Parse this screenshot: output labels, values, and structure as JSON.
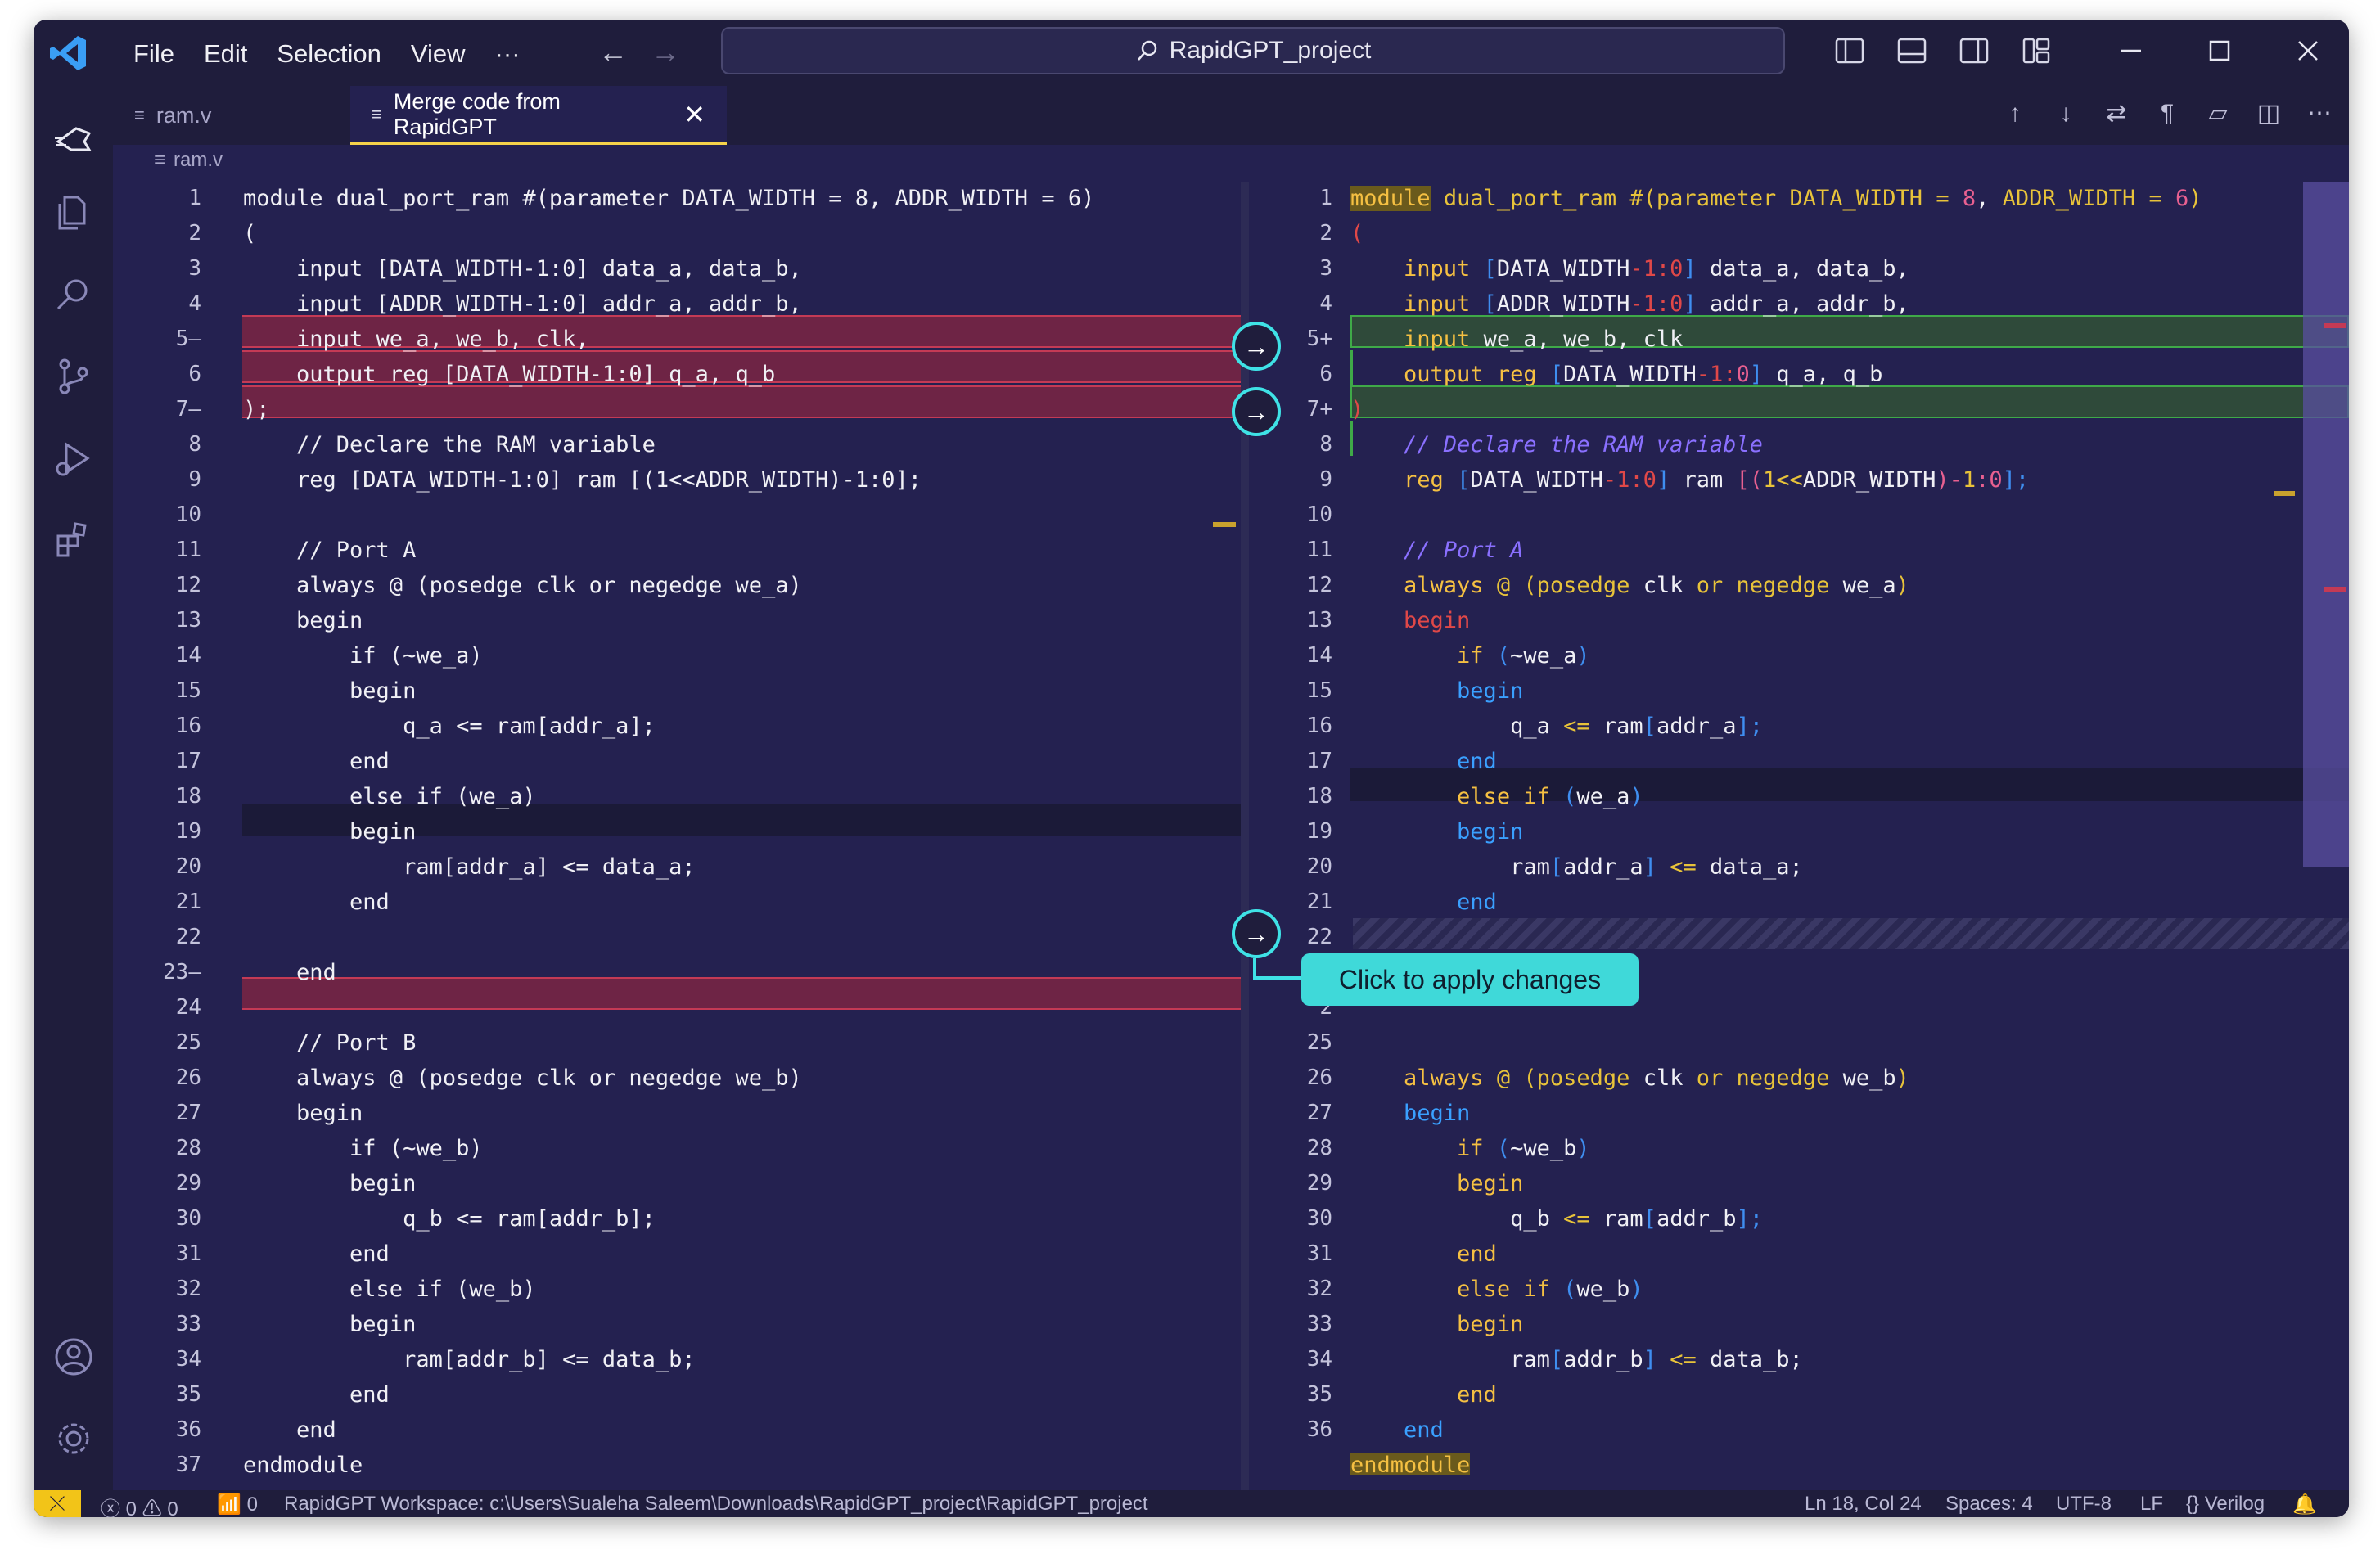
{
  "titlebar": {
    "menu": [
      "File",
      "Edit",
      "Selection",
      "View",
      "···"
    ],
    "search_text": "RapidGPT_project"
  },
  "tabs": [
    {
      "label": "ram.v",
      "active": false
    },
    {
      "label": "Merge code from RapidGPT",
      "active": true
    }
  ],
  "breadcrumb": "ram.v",
  "left_lines": [
    {
      "n": "1",
      "t": "module dual_port_ram #(parameter DATA_WIDTH = 8, ADDR_WIDTH = 6)"
    },
    {
      "n": "2",
      "t": "("
    },
    {
      "n": "3",
      "t": "    input [DATA_WIDTH-1:0] data_a, data_b,"
    },
    {
      "n": "4",
      "t": "    input [ADDR_WIDTH-1:0] addr_a, addr_b,"
    },
    {
      "n": "5—",
      "t": "    input we_a, we_b, clk,"
    },
    {
      "n": "6",
      "t": "    output reg [DATA_WIDTH-1:0] q_a, q_b"
    },
    {
      "n": "7—",
      "t": ");"
    },
    {
      "n": "8",
      "t": "    // Declare the RAM variable"
    },
    {
      "n": "9",
      "t": "    reg [DATA_WIDTH-1:0] ram [(1<<ADDR_WIDTH)-1:0];"
    },
    {
      "n": "10",
      "t": ""
    },
    {
      "n": "11",
      "t": "    // Port A"
    },
    {
      "n": "12",
      "t": "    always @ (posedge clk or negedge we_a)"
    },
    {
      "n": "13",
      "t": "    begin"
    },
    {
      "n": "14",
      "t": "        if (~we_a)"
    },
    {
      "n": "15",
      "t": "        begin"
    },
    {
      "n": "16",
      "t": "            q_a <= ram[addr_a];"
    },
    {
      "n": "17",
      "t": "        end"
    },
    {
      "n": "18",
      "t": "        else if (we_a)"
    },
    {
      "n": "19",
      "t": "        begin"
    },
    {
      "n": "20",
      "t": "            ram[addr_a] <= data_a;"
    },
    {
      "n": "21",
      "t": "        end"
    },
    {
      "n": "22",
      "t": ""
    },
    {
      "n": "23—",
      "t": "    end"
    },
    {
      "n": "24",
      "t": ""
    },
    {
      "n": "25",
      "t": "    // Port B"
    },
    {
      "n": "26",
      "t": "    always @ (posedge clk or negedge we_b)"
    },
    {
      "n": "27",
      "t": "    begin"
    },
    {
      "n": "28",
      "t": "        if (~we_b)"
    },
    {
      "n": "29",
      "t": "        begin"
    },
    {
      "n": "30",
      "t": "            q_b <= ram[addr_b];"
    },
    {
      "n": "31",
      "t": "        end"
    },
    {
      "n": "32",
      "t": "        else if (we_b)"
    },
    {
      "n": "33",
      "t": "        begin"
    },
    {
      "n": "34",
      "t": "            ram[addr_b] <= data_b;"
    },
    {
      "n": "35",
      "t": "        end"
    },
    {
      "n": "36",
      "t": "    end"
    },
    {
      "n": "37",
      "t": "endmodule"
    }
  ],
  "right_line_numbers": [
    "1",
    "2",
    "3",
    "4",
    "5+",
    "6",
    "7+",
    "8",
    "9",
    "10",
    "11",
    "12",
    "13",
    "14",
    "15",
    "16",
    "17",
    "18",
    "19",
    "20",
    "21",
    "22",
    "2",
    "2",
    "25",
    "26",
    "27",
    "28",
    "29",
    "30",
    "31",
    "32",
    "33",
    "34",
    "35",
    "36"
  ],
  "right_code": {
    "l1": [
      "module",
      "dual_port_ram",
      "#(",
      "parameter",
      "DATA_WIDTH",
      "=",
      "8",
      ",",
      "ADDR_WIDTH",
      "6",
      ")"
    ],
    "l2": "(",
    "l3": [
      "input",
      "[",
      "DATA_WIDTH",
      "-1:0",
      "]",
      "data_a, data_b,"
    ],
    "l4": [
      "input",
      "[",
      "ADDR_WIDTH",
      "-1:0",
      "]",
      "addr_a, addr_b,"
    ],
    "l5": [
      "input",
      "we_a, we_b, clk"
    ],
    "l6": [
      "output",
      "reg",
      "[",
      "DATA_WIDTH",
      "-1:",
      "0",
      "]",
      "q_a, q_b"
    ],
    "l7": ")",
    "l8": "// Declare the RAM variable",
    "l9": [
      "reg",
      "[",
      "DATA_WIDTH",
      "-1:0",
      "]",
      "ram",
      "[(",
      "1",
      "<<",
      "ADDR_WIDTH",
      ")-",
      "1",
      ":0",
      "];"
    ],
    "l11": "// Port A",
    "l12": [
      "always",
      "@",
      "(",
      "posedge",
      "clk",
      "or",
      "negedge",
      "we_a",
      ")"
    ],
    "l13": "begin",
    "l14": [
      "if",
      "(",
      "~we_a",
      ")"
    ],
    "l15": "begin",
    "l16": [
      "q_a",
      "<=",
      "ram",
      "[",
      "addr_a",
      "];"
    ],
    "l17": "end",
    "l18": [
      "else if",
      "(",
      "we_a",
      ")"
    ],
    "l19": "begin",
    "l20": [
      "ram",
      "[",
      "addr_a",
      "]",
      "<=",
      "data_a;"
    ],
    "l21": "end",
    "l25": [
      "always",
      "@",
      "(",
      "posedge",
      "clk",
      "or",
      "negedge",
      "we_b",
      ")"
    ],
    "l26": "begin",
    "l27": [
      "if",
      "(",
      "~we_b",
      ")"
    ],
    "l28": "begin",
    "l29": [
      "q_b",
      "<=",
      "ram",
      "[",
      "addr_b",
      "];"
    ],
    "l30": "end",
    "l31": [
      "else if",
      "(",
      "we_b",
      ")"
    ],
    "l32": "begin",
    "l33": [
      "ram",
      "[",
      "addr_b",
      "]",
      "<=",
      "data_b;"
    ],
    "l34": "end",
    "l35": "end",
    "l36": "endmodule"
  },
  "tooltip": "Click to apply changes",
  "status": {
    "errors": "0",
    "warnings": "0",
    "ports": "0",
    "workspace": "RapidGPT Workspace: c:\\Users\\Sualeha Saleem\\Downloads\\RapidGPT_project\\RapidGPT_project",
    "position": "Ln 18, Col 24",
    "spaces": "Spaces: 4",
    "encoding": "UTF-8",
    "eol": "LF",
    "language": "Verilog"
  },
  "colors": {
    "background": "#242150",
    "deleted_line": "#6e2445",
    "added_line": "#2f4a3a",
    "accent_cyan": "#3fe2e6",
    "keyword": "#f5c042",
    "keyword_blue": "#3aa0ff",
    "comment": "#8a70ff"
  }
}
